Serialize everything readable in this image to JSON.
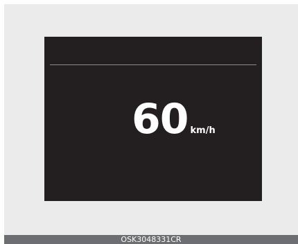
{
  "display": {
    "speed_value": "60",
    "speed_unit": "km/h"
  },
  "caption": {
    "code": "OSK3048331CR"
  },
  "colors": {
    "screen_background": "#231f20",
    "frame_background": "#ebebeb",
    "caption_background": "#6d6e71",
    "text": "#ffffff"
  }
}
